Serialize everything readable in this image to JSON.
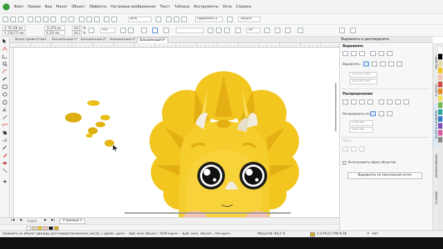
{
  "menu": [
    "Файл",
    "Правка",
    "Вид",
    "Макет",
    "Объект",
    "Эффекты",
    "Растровые изображения",
    "Текст",
    "Таблица",
    "Инструменты",
    "Окно",
    "Справка"
  ],
  "toolbar1": {
    "zoom": "85%",
    "snap_label": "Привязать к",
    "launch_label": "Запуск"
  },
  "toolbar2": {
    "x_field": "X: 76,108 мм",
    "y_field": "Y: 218,272 мм",
    "w_field": "11,878 мм",
    "h_field": "8,324 мм",
    "scale_w": "84,2",
    "scale_h": "84,2",
    "pct1": "%",
    "pct2": "%",
    "angle": "0,0",
    "outline_size": "50"
  },
  "doc_tabs": [
    "Экран приветствия",
    "Безымянный-1*",
    "Безымянный-2*",
    "Безымянный-3*",
    "Безымянный-4*"
  ],
  "active_tab_index": 4,
  "page": {
    "page_tab": "Страница 1",
    "page_count": "1 из 1"
  },
  "panel": {
    "title": "Выровнять и распределить",
    "align_section": "Выровнять",
    "align_to_label": "Выровнять:",
    "x_value": "103,071 мм",
    "y_value": "146,505 мм",
    "distribute_section": "Распределение",
    "distribute_to_label": "Распределить по:",
    "spacing_h": "2,00 мм",
    "spacing_v": "0,00 мм",
    "text_section": "Текст",
    "use_outline_label": "Использовать абрис объектов",
    "pixel_grid_button": "Выровнять по пиксельной сетке"
  },
  "dock_tabs": [
    "Свойства",
    "Объекты",
    "Выровнять и распр.",
    "Преобразования",
    "Эффекты"
  ],
  "status": {
    "hint": "Нажмите на объект дважды для поворота/наклона; инстр. с двойн. щелч. - выб. всех объект.; Shift+щелч. - выб. неск. объект.; Alt+щелч. - цифры; Ctrl+щелч. - выб. в группе",
    "zoom_text": "Масштаб: 84,2 %",
    "color_text": "C:0 M:22 Y:98 K:18",
    "fill_none": "Нет"
  },
  "colors": {
    "accent": "#3a7bd5",
    "dino_main": "#f2c61f",
    "dino_dark": "#e3af12",
    "dino_light": "#f8da55",
    "horn": "#f3ece0",
    "cheek": "#f6c4b4"
  },
  "palette": [
    "#ffffff",
    "#000000",
    "#e8d8a8",
    "#f2c61f",
    "#f6c4b4",
    "#d84a4a",
    "#e88b22",
    "#f0e15a",
    "#72b84f",
    "#2aa6a0",
    "#3278c8",
    "#7a4fb8",
    "#d85aa0",
    "#888888"
  ]
}
